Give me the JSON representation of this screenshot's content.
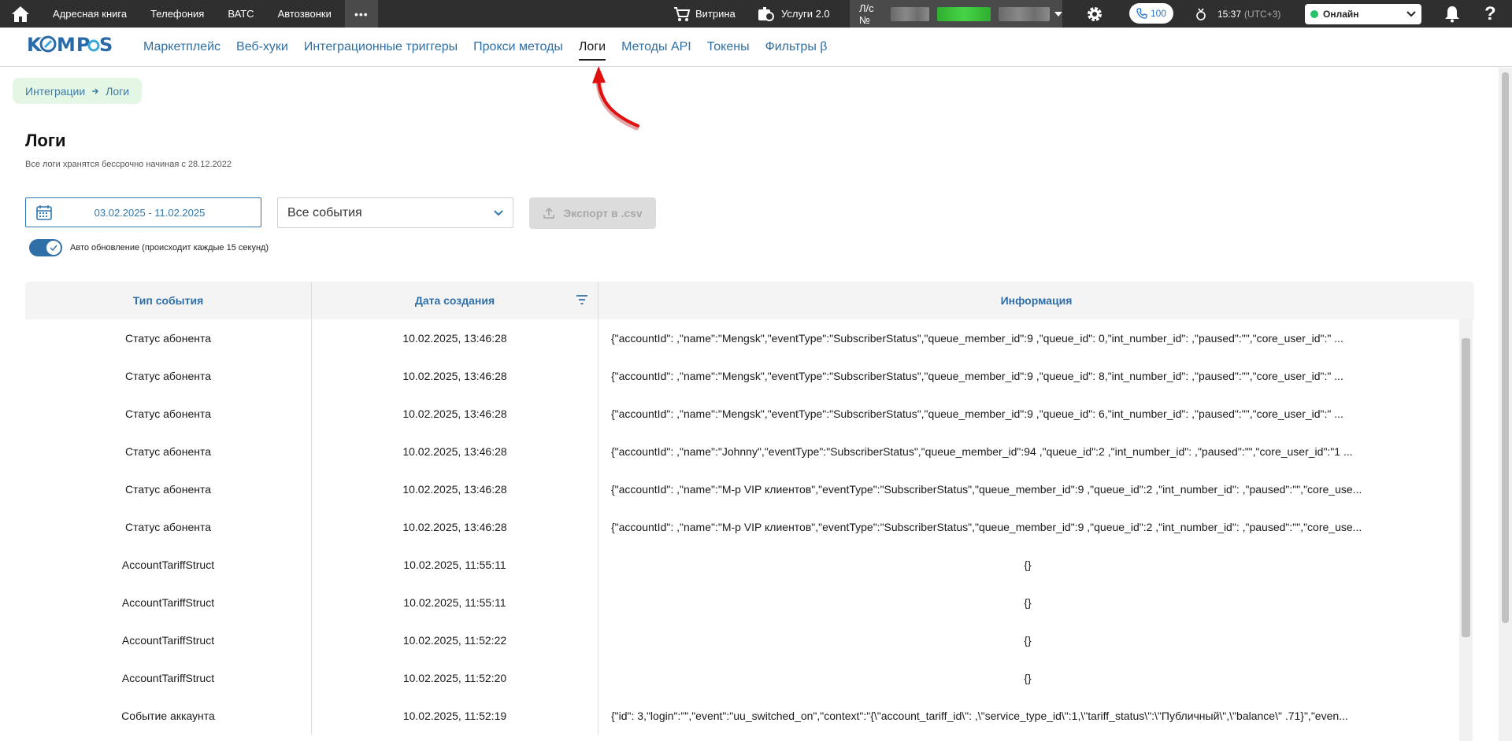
{
  "topbar": {
    "nav": [
      "Адресная книга",
      "Телефония",
      "ВАТС",
      "Автозвонки"
    ],
    "more_label": "•••",
    "shop_label": "Витрина",
    "services_label": "Услуги 2.0",
    "account_label": "Л/с №",
    "calls_count": "100",
    "time": "15:37",
    "timezone": "(UTC+3)",
    "status_label": "Онлайн",
    "help_label": "?"
  },
  "subnav": {
    "logo_text": "KOMPAS",
    "links": [
      "Маркетплейс",
      "Веб-хуки",
      "Интеграционные триггеры",
      "Прокси методы",
      "Логи",
      "Методы API",
      "Токены",
      "Фильтры β"
    ],
    "active_index": 4
  },
  "breadcrumb": {
    "items": [
      "Интеграции",
      "Логи"
    ]
  },
  "page": {
    "title": "Логи",
    "subtitle": "Все логи хранятся бессрочно начиная с 28.12.2022"
  },
  "filters": {
    "date_range": "03.02.2025 - 11.02.2025",
    "event_select": "Все события",
    "export_label": "Экспорт в .csv",
    "auto_update_label": "Авто обновление (происходит каждые 15 секунд)",
    "auto_update_on": true
  },
  "table": {
    "headers": [
      "Тип события",
      "Дата создания",
      "Информация"
    ],
    "rows": [
      {
        "type": "Статус абонента",
        "date": "10.02.2025, 13:46:28",
        "info": "{\"accountId\":        ,\"name\":\"Mengsk\",\"eventType\":\"SubscriberStatus\",\"queue_member_id\":9        ,\"queue_id\":        0,\"int_number_id\":        ,\"paused\":\"\",\"core_user_id\":\"        ..."
      },
      {
        "type": "Статус абонента",
        "date": "10.02.2025, 13:46:28",
        "info": "{\"accountId\":        ,\"name\":\"Mengsk\",\"eventType\":\"SubscriberStatus\",\"queue_member_id\":9        ,\"queue_id\":        8,\"int_number_id\":        ,\"paused\":\"\",\"core_user_id\":\"        ..."
      },
      {
        "type": "Статус абонента",
        "date": "10.02.2025, 13:46:28",
        "info": "{\"accountId\":        ,\"name\":\"Mengsk\",\"eventType\":\"SubscriberStatus\",\"queue_member_id\":9        ,\"queue_id\":        6,\"int_number_id\":        ,\"paused\":\"\",\"core_user_id\":\"        ..."
      },
      {
        "type": "Статус абонента",
        "date": "10.02.2025, 13:46:28",
        "info": "{\"accountId\":        ,\"name\":\"Johnny\",\"eventType\":\"SubscriberStatus\",\"queue_member_id\":94        ,\"queue_id\":2        ,\"int_number_id\":        ,\"paused\":\"\",\"core_user_id\":\"1        ..."
      },
      {
        "type": "Статус абонента",
        "date": "10.02.2025, 13:46:28",
        "info": "{\"accountId\":        ,\"name\":\"М-р VIP клиентов\",\"eventType\":\"SubscriberStatus\",\"queue_member_id\":9        ,\"queue_id\":2        ,\"int_number_id\":        ,\"paused\":\"\",\"core_use..."
      },
      {
        "type": "Статус абонента",
        "date": "10.02.2025, 13:46:28",
        "info": "{\"accountId\":        ,\"name\":\"М-р VIP клиентов\",\"eventType\":\"SubscriberStatus\",\"queue_member_id\":9        ,\"queue_id\":2        ,\"int_number_id\":        ,\"paused\":\"\",\"core_use..."
      },
      {
        "type": "AccountTariffStruct",
        "date": "10.02.2025, 11:55:11",
        "info": "{}"
      },
      {
        "type": "AccountTariffStruct",
        "date": "10.02.2025, 11:55:11",
        "info": "{}"
      },
      {
        "type": "AccountTariffStruct",
        "date": "10.02.2025, 11:52:22",
        "info": "{}"
      },
      {
        "type": "AccountTariffStruct",
        "date": "10.02.2025, 11:52:20",
        "info": "{}"
      },
      {
        "type": "Событие аккаунта",
        "date": "10.02.2025, 11:52:19",
        "info": "{\"id\":        3,\"login\":\"\",\"event\":\"uu_switched_on\",\"context\":\"{\\\"account_tariff_id\\\":        ,\\\"service_type_id\\\":1,\\\"tariff_status\\\":\\\"Публичный\\\",\\\"balance\\\"        .71}\",\"even..."
      }
    ]
  },
  "colors": {
    "topbar_bg": "#2f2f2f",
    "accent_blue": "#2f6fa8",
    "breadcrumb_bg": "#e4f6e4",
    "status_green": "#27c26a",
    "annotation_red": "#e01010"
  }
}
